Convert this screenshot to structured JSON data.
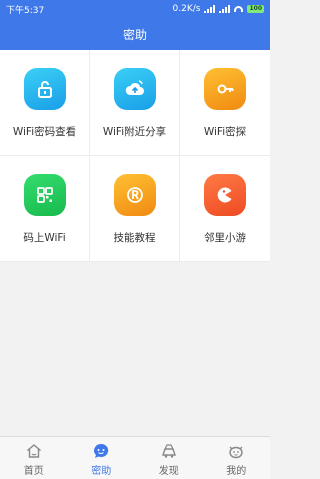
{
  "status": {
    "time": "下午5:37",
    "speed": "0.2K/s",
    "battery": "100"
  },
  "header": {
    "title": "密助"
  },
  "tools": [
    {
      "label": "WiFi密码查看",
      "icon": "lock-icon"
    },
    {
      "label": "WiFi附近分享",
      "icon": "cloud-upload-icon"
    },
    {
      "label": "WiFi密探",
      "icon": "key-icon"
    },
    {
      "label": "码上WiFi",
      "icon": "qr-code-icon"
    },
    {
      "label": "技能教程",
      "icon": "tutorial-icon"
    },
    {
      "label": "邻里小游",
      "icon": "pacman-icon"
    }
  ],
  "tabs": [
    {
      "label": "首页",
      "icon": "home-icon",
      "active": false
    },
    {
      "label": "密助",
      "icon": "chat-bubble-icon",
      "active": true
    },
    {
      "label": "发现",
      "icon": "discover-icon",
      "active": false
    },
    {
      "label": "我的",
      "icon": "profile-icon",
      "active": false
    }
  ],
  "colors": {
    "brand": "#3f78e8"
  }
}
